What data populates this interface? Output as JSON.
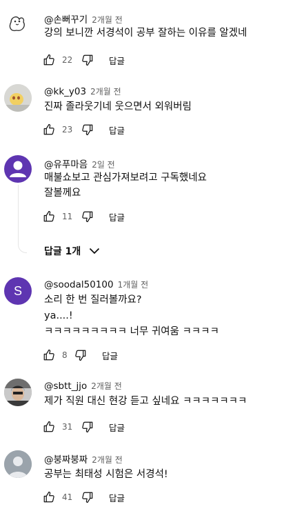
{
  "comments": [
    {
      "handle": "@손뻐꾸기",
      "time": "2개월 전",
      "lines": [
        "강의 보니깐 서경석이 공부 잘하는 이유를 알겠네"
      ],
      "likes": "22",
      "reply_label": "답글",
      "avatar": "bird-doodle-avatar"
    },
    {
      "handle": "@kk_y03",
      "time": "2개월 전",
      "lines": [
        "진짜 졸라웃기네 웃으면서 외워버림"
      ],
      "likes": "23",
      "reply_label": "답글",
      "avatar": "photo-avatar"
    },
    {
      "handle": "@유푸마음",
      "time": "2일 전",
      "lines": [
        "매불쇼보고 관심가져보려고 구독했네요",
        "잘볼께요"
      ],
      "likes": "11",
      "reply_label": "답글",
      "avatar": "default-person-avatar",
      "replies_label": "답글 1개"
    },
    {
      "handle": "@soodal50100",
      "time": "1개월 전",
      "lines": [
        "소리 한 번 질러볼까요?",
        "ya....!",
        "ㅋㅋㅋㅋㅋㅋㅋㅋㅋ 너무 귀여움 ㅋㅋㅋㅋ"
      ],
      "likes": "8",
      "reply_label": "답글",
      "avatar_letter": "S",
      "avatar": "letter-avatar"
    },
    {
      "handle": "@sbtt_jjo",
      "time": "2개월 전",
      "lines": [
        "제가 직원 대신 현강 듣고 싶네요 ㅋㅋㅋㅋㅋㅋㅋ"
      ],
      "likes": "31",
      "reply_label": "답글",
      "avatar": "photo-avatar"
    },
    {
      "handle": "@붕짜붕짜",
      "time": "2개월 전",
      "lines": [
        "공부는 최태성 시험은 서경석!"
      ],
      "likes": "41",
      "reply_label": "답글",
      "avatar": "default-avatar"
    }
  ],
  "colors": {
    "purple_avatar": "#5e35b1",
    "text": "#0f0f0f",
    "secondary": "#606060"
  }
}
